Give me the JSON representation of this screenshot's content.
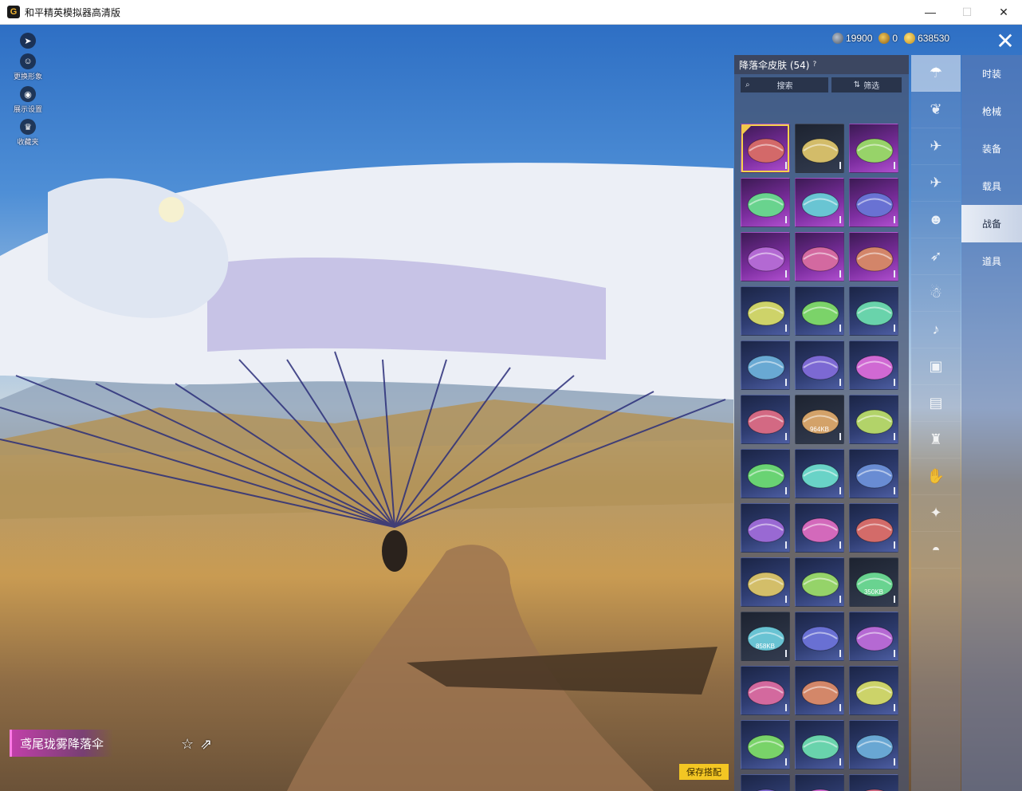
{
  "window": {
    "title": "和平精英模拟器高清版",
    "app_icon": "G",
    "minimize": "—",
    "maximize": "☐",
    "close": "✕"
  },
  "left_tools": [
    {
      "icon": "arrow-right-icon",
      "glyph": "➤",
      "label": ""
    },
    {
      "icon": "avatar-icon",
      "glyph": "☺",
      "label": "更换形象"
    },
    {
      "icon": "eye-icon",
      "glyph": "◉",
      "label": "展示设置"
    },
    {
      "icon": "collection-icon",
      "glyph": "♛",
      "label": "收藏夹"
    }
  ],
  "currencies": [
    {
      "icon": "silver-coin-icon",
      "value": "19900"
    },
    {
      "icon": "gold-coupon-icon",
      "value": "0"
    },
    {
      "icon": "gold-coin-icon",
      "value": "638530"
    }
  ],
  "close_label": "✕",
  "panel": {
    "title": "降落伞皮肤 (54)",
    "info_glyph": "?",
    "search_placeholder": "搜索",
    "filter_label": "筛选",
    "items": [
      {
        "tier": "purple",
        "selected": true,
        "size": ""
      },
      {
        "tier": "gray",
        "selected": false,
        "size": ""
      },
      {
        "tier": "purple",
        "selected": false,
        "size": ""
      },
      {
        "tier": "purple",
        "selected": false,
        "size": ""
      },
      {
        "tier": "purple",
        "selected": false,
        "size": ""
      },
      {
        "tier": "purple",
        "selected": false,
        "size": ""
      },
      {
        "tier": "purple",
        "selected": false,
        "size": ""
      },
      {
        "tier": "purple",
        "selected": false,
        "size": ""
      },
      {
        "tier": "purple",
        "selected": false,
        "size": ""
      },
      {
        "tier": "blue",
        "selected": false,
        "size": ""
      },
      {
        "tier": "blue",
        "selected": false,
        "size": ""
      },
      {
        "tier": "blue",
        "selected": false,
        "size": ""
      },
      {
        "tier": "blue",
        "selected": false,
        "size": ""
      },
      {
        "tier": "blue",
        "selected": false,
        "size": ""
      },
      {
        "tier": "blue",
        "selected": false,
        "size": ""
      },
      {
        "tier": "blue",
        "selected": false,
        "size": ""
      },
      {
        "tier": "gray",
        "selected": false,
        "size": "964KB"
      },
      {
        "tier": "blue",
        "selected": false,
        "size": ""
      },
      {
        "tier": "blue",
        "selected": false,
        "size": ""
      },
      {
        "tier": "blue",
        "selected": false,
        "size": ""
      },
      {
        "tier": "blue",
        "selected": false,
        "size": ""
      },
      {
        "tier": "blue",
        "selected": false,
        "size": ""
      },
      {
        "tier": "blue",
        "selected": false,
        "size": ""
      },
      {
        "tier": "blue",
        "selected": false,
        "size": ""
      },
      {
        "tier": "blue",
        "selected": false,
        "size": ""
      },
      {
        "tier": "blue",
        "selected": false,
        "size": ""
      },
      {
        "tier": "gray",
        "selected": false,
        "size": "350KB"
      },
      {
        "tier": "gray",
        "selected": false,
        "size": "858KB"
      },
      {
        "tier": "blue",
        "selected": false,
        "size": ""
      },
      {
        "tier": "blue",
        "selected": false,
        "size": ""
      },
      {
        "tier": "blue",
        "selected": false,
        "size": ""
      },
      {
        "tier": "blue",
        "selected": false,
        "size": ""
      },
      {
        "tier": "blue",
        "selected": false,
        "size": ""
      },
      {
        "tier": "blue",
        "selected": false,
        "size": ""
      },
      {
        "tier": "blue",
        "selected": false,
        "size": ""
      },
      {
        "tier": "blue",
        "selected": false,
        "size": ""
      },
      {
        "tier": "blue",
        "selected": false,
        "size": ""
      },
      {
        "tier": "blue",
        "selected": false,
        "size": ""
      },
      {
        "tier": "blue",
        "selected": false,
        "size": ""
      }
    ]
  },
  "icon_categories": [
    {
      "name": "parachute-icon",
      "glyph": "☂",
      "active": true
    },
    {
      "name": "wings-icon",
      "glyph": "❦",
      "active": false
    },
    {
      "name": "drone-icon",
      "glyph": "✈",
      "active": false
    },
    {
      "name": "plane-icon",
      "glyph": "✈",
      "active": false
    },
    {
      "name": "emote-icon",
      "glyph": "☻",
      "active": false
    },
    {
      "name": "jet-icon",
      "glyph": "➶",
      "active": false
    },
    {
      "name": "companion-icon",
      "glyph": "☃",
      "active": false
    },
    {
      "name": "sound-icon",
      "glyph": "♪",
      "active": false
    },
    {
      "name": "badge-icon",
      "glyph": "▣",
      "active": false
    },
    {
      "name": "gallery-icon",
      "glyph": "▤",
      "active": false
    },
    {
      "name": "extinguisher-icon",
      "glyph": "♜",
      "active": false
    },
    {
      "name": "hand-icon",
      "glyph": "✋",
      "active": false
    },
    {
      "name": "magic-wand-icon",
      "glyph": "✦",
      "active": false
    },
    {
      "name": "landing-icon",
      "glyph": "◓",
      "active": false
    }
  ],
  "text_categories": [
    {
      "label": "时装",
      "active": false
    },
    {
      "label": "枪械",
      "active": false
    },
    {
      "label": "装备",
      "active": false
    },
    {
      "label": "载具",
      "active": false
    },
    {
      "label": "战备",
      "active": true
    },
    {
      "label": "道具",
      "active": false
    }
  ],
  "item": {
    "name": "鸢尾珑雾降落伞",
    "favorite_glyph": "☆",
    "share_glyph": "⇗"
  },
  "save_label": "保存搭配",
  "colors": {
    "accent_gold": "#f3c623",
    "rarity_purple": "#7d2ea0",
    "rarity_blue": "#303e73",
    "name_tag_pink": "#c83cb4"
  }
}
